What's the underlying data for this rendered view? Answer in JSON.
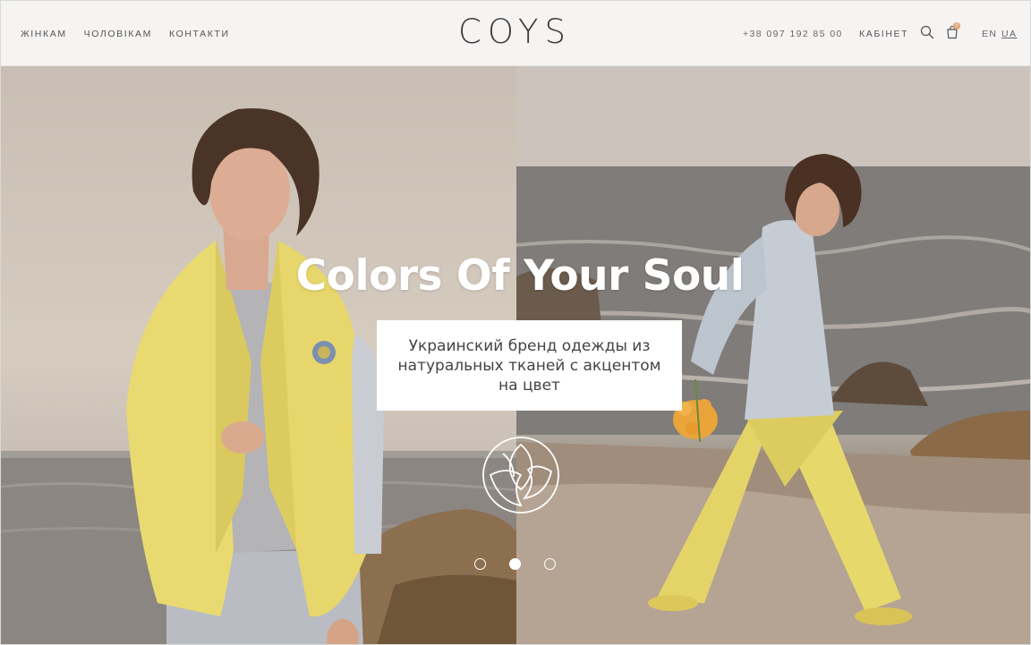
{
  "header": {
    "nav_left": [
      "ЖІНКАМ",
      "ЧОЛОВІКАМ",
      "КОНТАКТИ"
    ],
    "logo": "COYS",
    "phone": "+38 097 192 85 00",
    "cabinet": "КАБІНЕТ",
    "cart_count": "0",
    "lang_en": "EN",
    "lang_ua": "UA",
    "icons": [
      "search-icon",
      "cart-icon"
    ]
  },
  "hero": {
    "title": "Colors Of Your Soul",
    "subtitle": "Украинский бренд одежды из натуральных тканей с акцентом на цвет",
    "emblem_icon": "lotus-emblem-icon",
    "slides_total": 3,
    "active_slide": 2
  },
  "colors": {
    "accent_badge": "#e0a472",
    "jacket_yellow": "#e8d86a",
    "header_bg": "#f6f4f3"
  }
}
